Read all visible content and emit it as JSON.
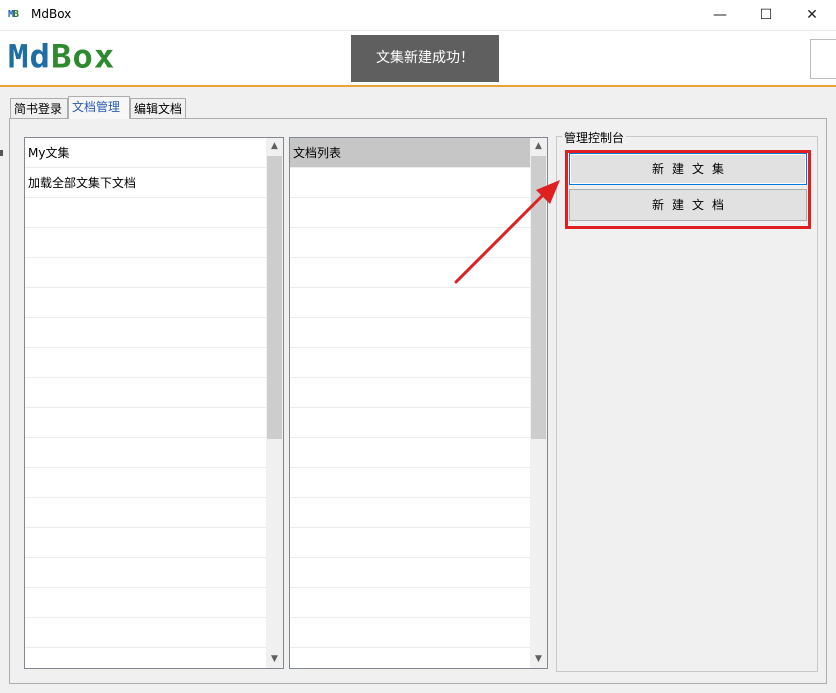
{
  "window": {
    "icon_text_m": "M",
    "icon_text_b": "B",
    "title": "MdBox",
    "minimize_glyph": "—",
    "maximize_glyph": "☐",
    "close_glyph": "✕"
  },
  "header": {
    "logo_md": "Md",
    "logo_box": "Box",
    "toast": "文集新建成功！"
  },
  "tabs": [
    {
      "label": "简书登录"
    },
    {
      "label": "文档管理"
    },
    {
      "label": "编辑文档"
    }
  ],
  "collections": {
    "items": [
      "My文集",
      "加载全部文集下文档"
    ]
  },
  "documents": {
    "items": [
      "文档列表"
    ]
  },
  "console": {
    "title": "管理控制台",
    "new_collection": "新建文集",
    "new_document": "新建文档"
  },
  "colors": {
    "accent_border": "#e8a33a",
    "annotation": "#e02020",
    "toast_bg": "#5f5f5f"
  }
}
